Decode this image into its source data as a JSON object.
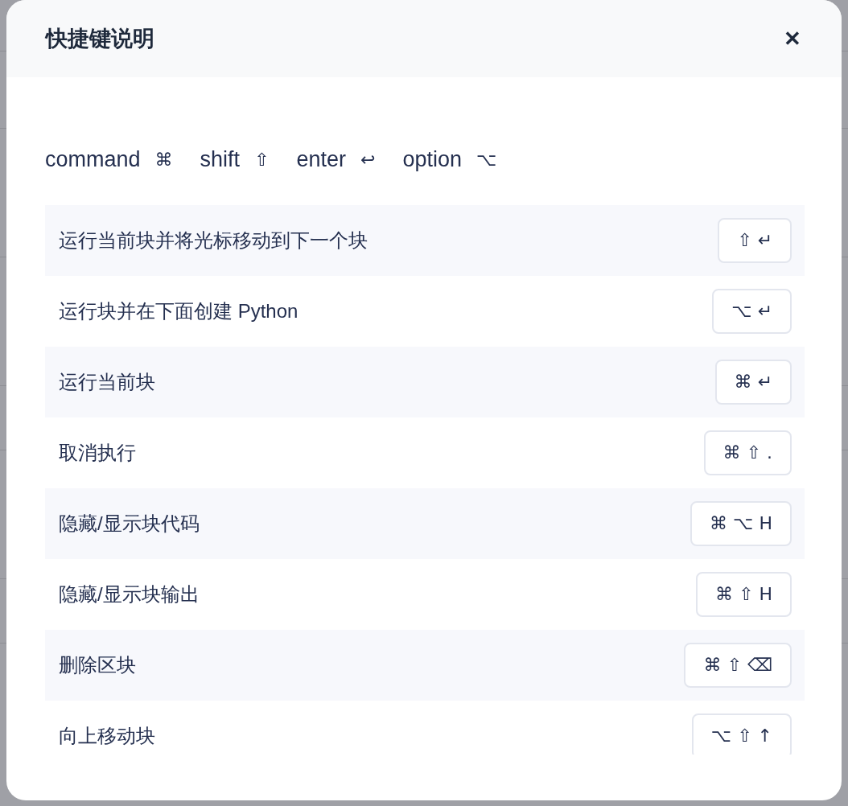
{
  "dialog": {
    "title": "快捷键说明",
    "close": "✕"
  },
  "legend": [
    {
      "name": "command",
      "symbol": "⌘"
    },
    {
      "name": "shift",
      "symbol": "⇧"
    },
    {
      "name": "enter",
      "symbol": "↩"
    },
    {
      "name": "option",
      "symbol": "⌥"
    }
  ],
  "shortcuts": [
    {
      "action": "运行当前块并将光标移动到下一个块",
      "keys": [
        "⇧",
        "↵"
      ]
    },
    {
      "action": "运行块并在下面创建 Python",
      "keys": [
        "⌥",
        "↵"
      ]
    },
    {
      "action": "运行当前块",
      "keys": [
        "⌘",
        "↵"
      ]
    },
    {
      "action": "取消执行",
      "keys": [
        "⌘",
        "⇧",
        "."
      ]
    },
    {
      "action": "隐藏/显示块代码",
      "keys": [
        "⌘",
        "⌥",
        "H"
      ]
    },
    {
      "action": "隐藏/显示块输出",
      "keys": [
        "⌘",
        "⇧",
        "H"
      ]
    },
    {
      "action": "删除区块",
      "keys": [
        "⌘",
        "⇧",
        "⌫"
      ]
    },
    {
      "action": "向上移动块",
      "keys": [
        "⌥",
        "⇧",
        "↑"
      ]
    }
  ]
}
